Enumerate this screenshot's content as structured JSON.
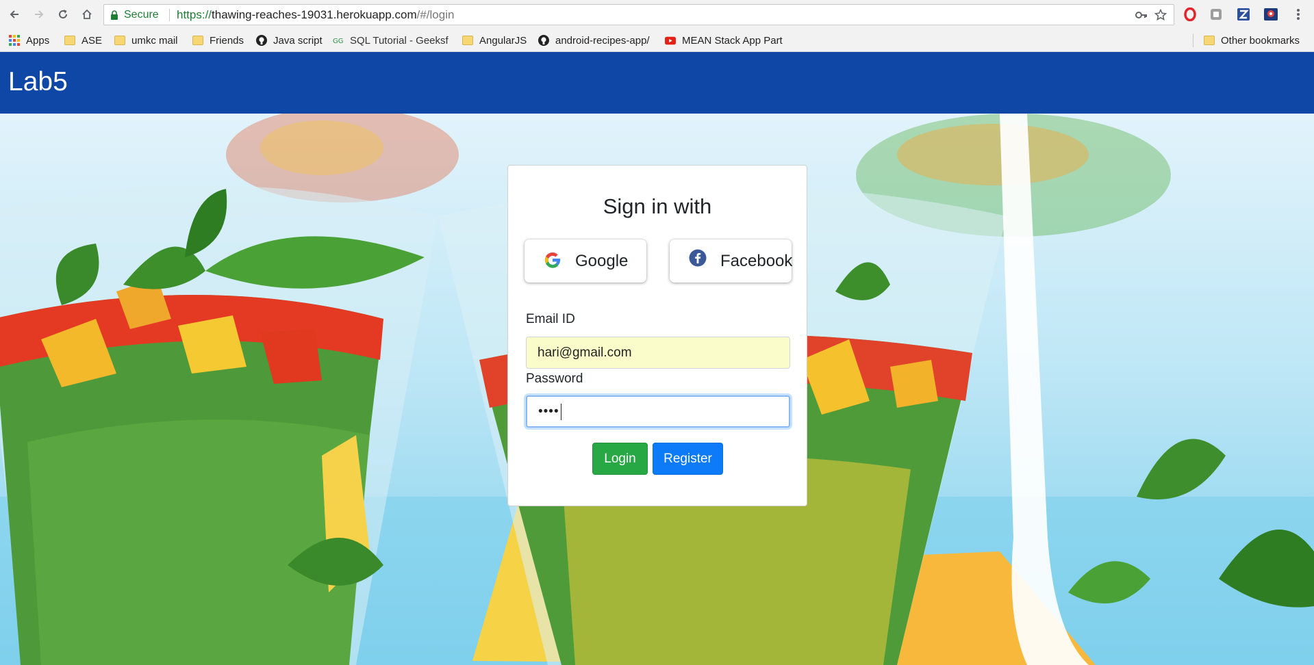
{
  "browser": {
    "secure_label": "Secure",
    "url_scheme": "https://",
    "url_host": "thawing-reaches-19031.herokuapp.com",
    "url_path": "/#/login",
    "bookmarks": [
      {
        "label": "Apps",
        "icon": "apps-grid-icon"
      },
      {
        "label": "ASE",
        "icon": "folder-icon"
      },
      {
        "label": "umkc mail",
        "icon": "folder-icon"
      },
      {
        "label": "Friends",
        "icon": "folder-icon"
      },
      {
        "label": "Java script",
        "icon": "github-icon"
      },
      {
        "label": "SQL Tutorial - Geeksf",
        "icon": "geeksforgeeks-icon"
      },
      {
        "label": "AngularJS",
        "icon": "folder-icon"
      },
      {
        "label": "android-recipes-app/",
        "icon": "github-icon"
      },
      {
        "label": "MEAN Stack App Part",
        "icon": "youtube-icon"
      }
    ],
    "other_bookmarks": "Other bookmarks"
  },
  "navbar": {
    "brand": "Lab5",
    "color": "#0f47a6"
  },
  "login": {
    "title": "Sign in with",
    "google_label": "Google",
    "facebook_label": "Facebook",
    "email_label": "Email ID",
    "email_value": "hari@gmail.com",
    "password_label": "Password",
    "password_masked": "••••",
    "login_label": "Login",
    "register_label": "Register",
    "login_color": "#28a745",
    "register_color": "#0d7af7"
  }
}
